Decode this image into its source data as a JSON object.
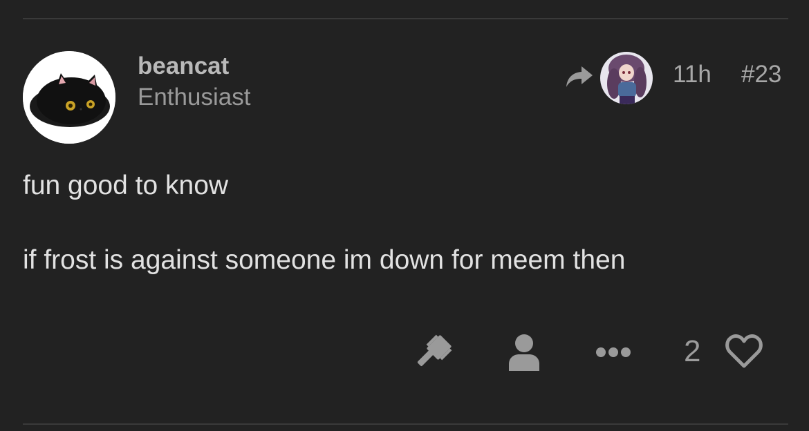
{
  "post": {
    "username": "beancat",
    "user_title": "Enthusiast",
    "time": "11h",
    "number": "#23",
    "paragraphs": [
      "fun good to know",
      "if frost is against someone im down for meem then"
    ]
  },
  "actions": {
    "like_count": "2",
    "icons": [
      "gavel-icon",
      "user-icon",
      "ellipsis-icon",
      "heart-icon"
    ]
  },
  "colors": {
    "background": "#222222",
    "divider": "#3a3a3a",
    "text": "#e2e2e2",
    "muted": "#9c9c9c"
  }
}
